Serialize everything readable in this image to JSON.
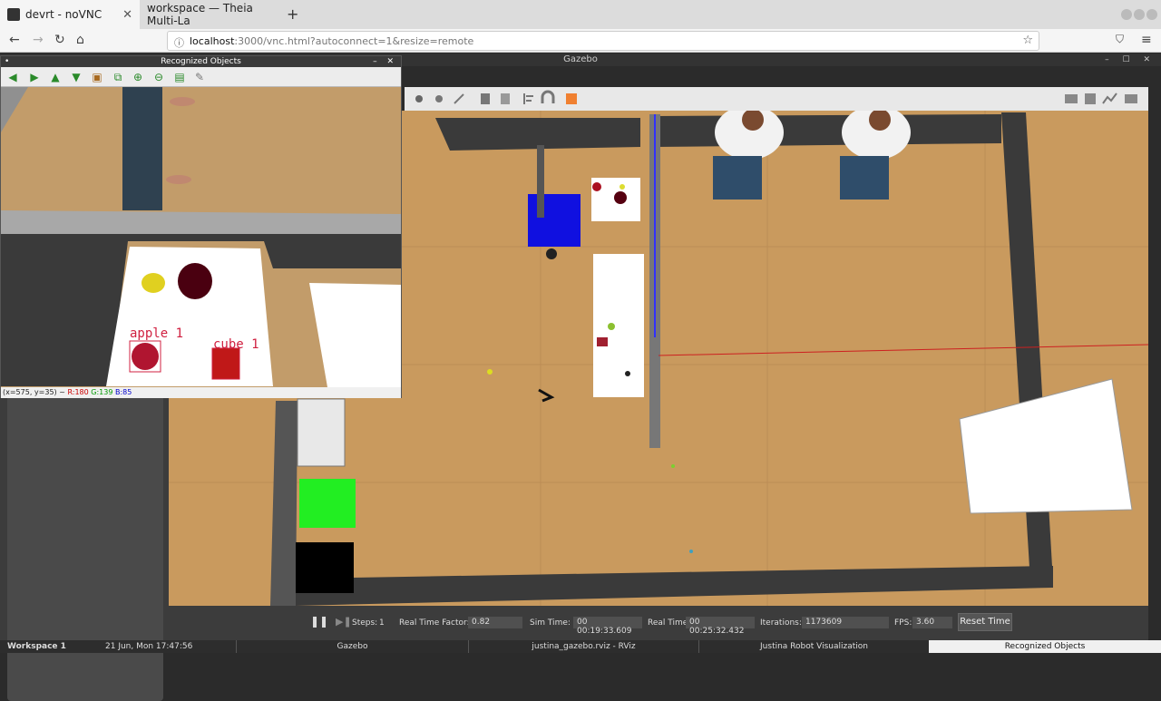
{
  "browser": {
    "tabs": [
      {
        "label": "devrt - noVNC",
        "active": true
      },
      {
        "label": "workspace — Theia Multi-La",
        "active": false
      }
    ],
    "url_host": "localhost",
    "url_rest": ":3000/vnc.html?autoconnect=1&resize=remote"
  },
  "gazebo": {
    "title": "Gazebo",
    "bottom": {
      "steps_label": "Steps:",
      "steps_value": "1",
      "rtf_label": "Real Time Factor:",
      "rtf_value": "0.82",
      "sim_label": "Sim Time:",
      "sim_value": "00 00:19:33.609",
      "real_label": "Real Time:",
      "real_value": "00 00:25:32.432",
      "iter_label": "Iterations:",
      "iter_value": "1173609",
      "fps_label": "FPS:",
      "fps_value": "3.60",
      "reset_label": "Reset Time"
    }
  },
  "recognized": {
    "title": "Recognized Objects",
    "labels": [
      "apple 1",
      "cube 1"
    ],
    "status_coords": "(x=575, y=35) ~",
    "status_r": "R:180",
    "status_g": "G:139",
    "status_b": "B:85"
  },
  "taskbar": {
    "items": [
      "Workspace 1",
      "21 Jun, Mon 17:47:56",
      "Gazebo",
      "justina_gazebo.rviz - RViz",
      "Justina Robot Visualization",
      "Recognized Objects"
    ]
  },
  "colors": {
    "floor": "#c99a5e",
    "wall": "#3a3a3a",
    "box_green": "#22ee22",
    "robot_blue": "#1010e0"
  }
}
